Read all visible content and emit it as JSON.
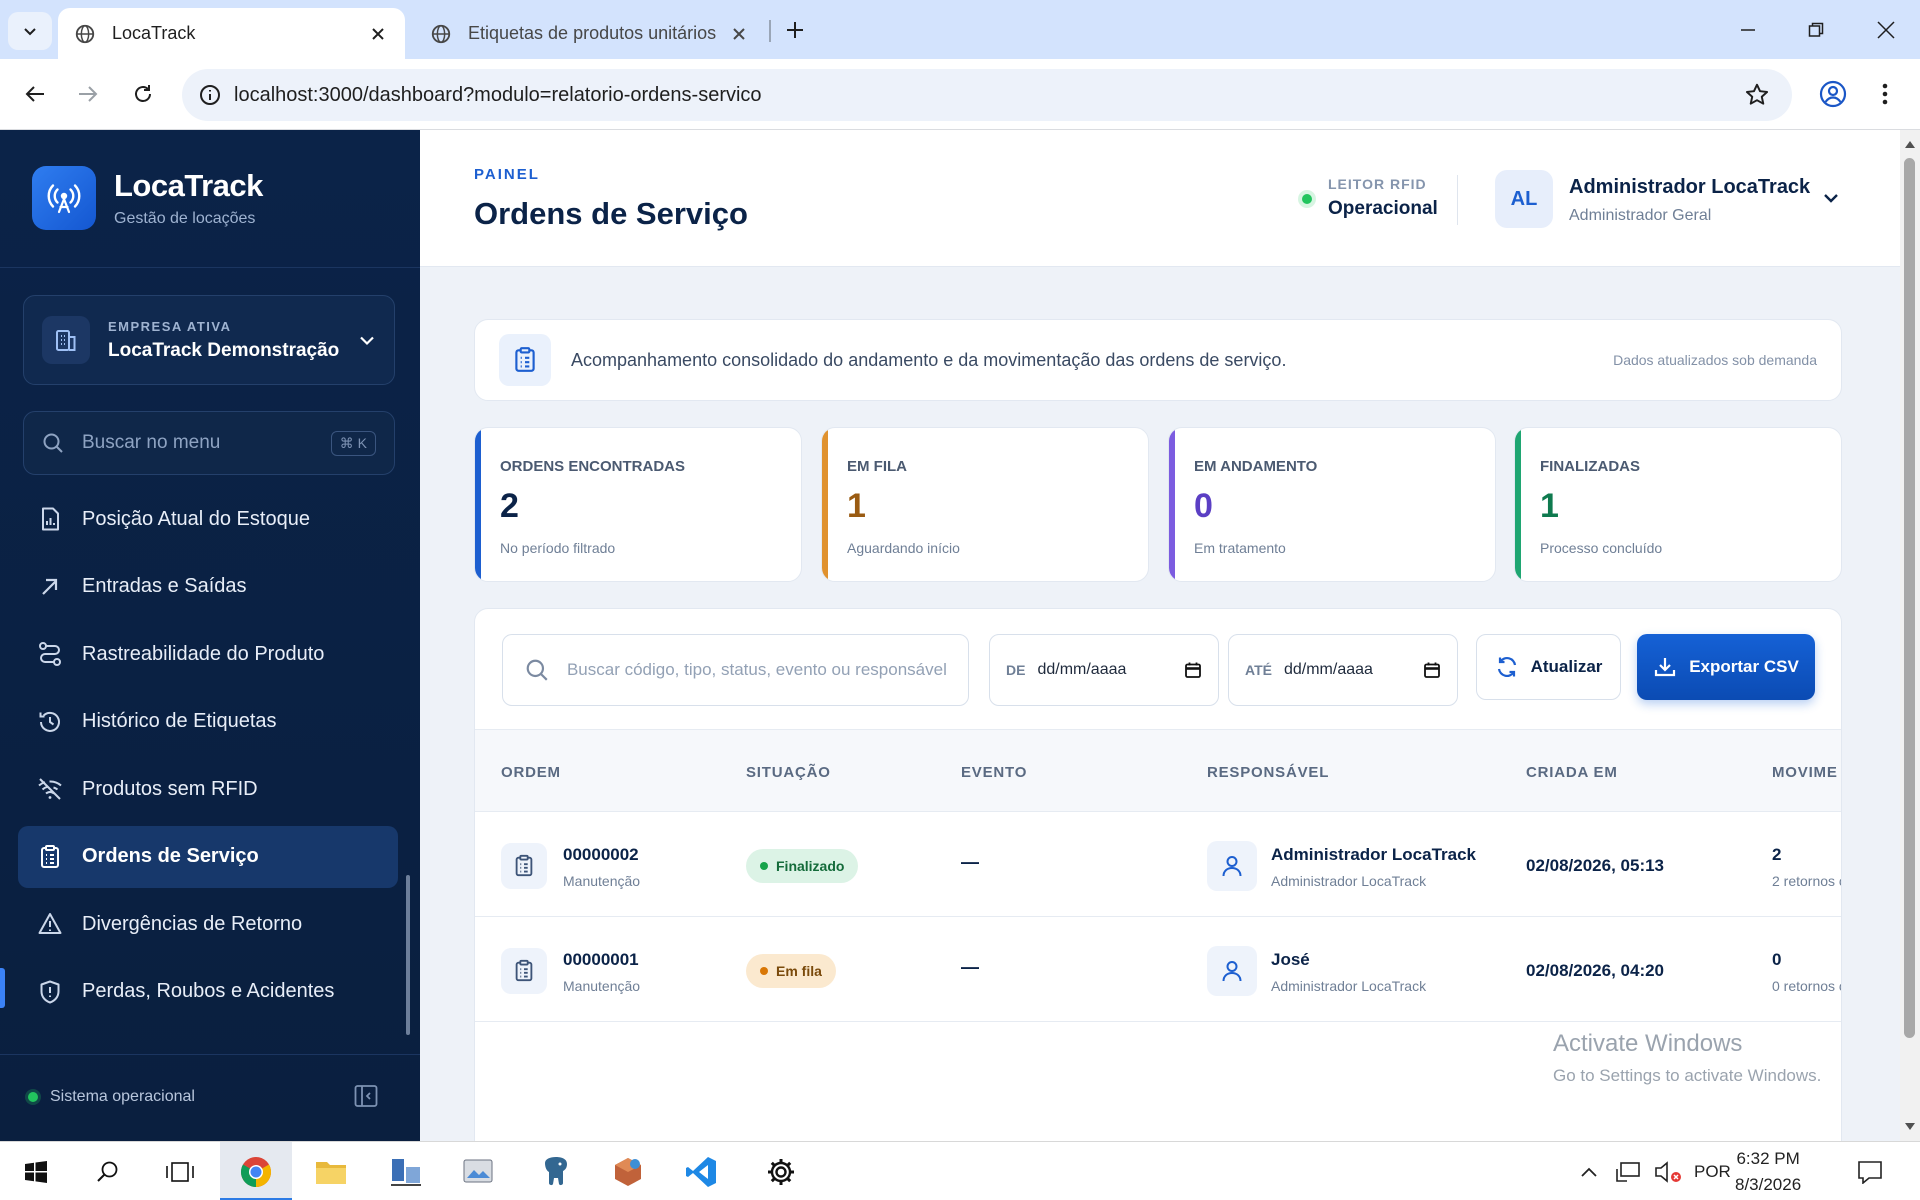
{
  "browser": {
    "tabs": [
      {
        "title": "LocaTrack",
        "active": true
      },
      {
        "title": "Etiquetas de produtos unitários",
        "active": false
      }
    ],
    "url": "localhost:3000/dashboard?modulo=relatorio-ordens-servico"
  },
  "sidebar": {
    "brand_name": "LocaTrack",
    "brand_sub": "Gestão de locações",
    "company_label": "EMPRESA ATIVA",
    "company_name": "LocaTrack Demonstração",
    "search_placeholder": "Buscar no menu",
    "search_shortcut": "⌘ K",
    "items": [
      {
        "label": "Posição Atual do Estoque",
        "icon": "inventory-report-icon"
      },
      {
        "label": "Entradas e Saídas",
        "icon": "arrow-up-right-icon"
      },
      {
        "label": "Rastreabilidade do Produto",
        "icon": "route-icon"
      },
      {
        "label": "Histórico de Etiquetas",
        "icon": "history-icon"
      },
      {
        "label": "Produtos sem RFID",
        "icon": "wifi-off-icon"
      },
      {
        "label": "Ordens de Serviço",
        "icon": "clipboard-icon",
        "active": true
      },
      {
        "label": "Divergências de Retorno",
        "icon": "warning-icon"
      },
      {
        "label": "Perdas, Roubos e Acidentes",
        "icon": "shield-alert-icon"
      }
    ],
    "status": "Sistema operacional"
  },
  "header": {
    "eyebrow": "PAINEL",
    "title": "Ordens de Serviço",
    "rfid_label": "LEITOR RFID",
    "rfid_status": "Operacional",
    "user_initials": "AL",
    "user_name": "Administrador LocaTrack",
    "user_role": "Administrador Geral"
  },
  "info": {
    "text": "Acompanhamento consolidado do andamento e da movimentação das ordens de serviço.",
    "note": "Dados atualizados sob demanda"
  },
  "stats": [
    {
      "label": "ORDENS ENCONTRADAS",
      "value": "2",
      "sub": "No período filtrado",
      "color": "#1d5fd0",
      "value_color": "#0b2348"
    },
    {
      "label": "EM FILA",
      "value": "1",
      "sub": "Aguardando início",
      "color": "#e0922f",
      "value_color": "#9a5b12"
    },
    {
      "label": "EM ANDAMENTO",
      "value": "0",
      "sub": "Em tratamento",
      "color": "#7c5ce0",
      "value_color": "#5b3fc4"
    },
    {
      "label": "FINALIZADAS",
      "value": "1",
      "sub": "Processo concluído",
      "color": "#1fa672",
      "value_color": "#0f7a4f"
    }
  ],
  "filters": {
    "search_placeholder": "Buscar código, tipo, status, evento ou responsável",
    "from_label": "DE",
    "from_value": "dd/mm/aaaa",
    "to_label": "ATÉ",
    "to_value": "dd/mm/aaaa",
    "refresh_label": "Atualizar",
    "export_label": "Exportar CSV"
  },
  "table": {
    "columns": [
      "ORDEM",
      "SITUAÇÃO",
      "EVENTO",
      "RESPONSÁVEL",
      "CRIADA EM",
      "MOVIME"
    ],
    "rows": [
      {
        "code": "00000002",
        "type": "Manutenção",
        "status": "Finalizado",
        "status_kind": "done",
        "event": "—",
        "resp_name": "Administrador LocaTrack",
        "resp_sub": "Administrador LocaTrack",
        "created": "02/08/2026, 05:13",
        "mov": "2",
        "mov_sub": "2 retornos c"
      },
      {
        "code": "00000001",
        "type": "Manutenção",
        "status": "Em fila",
        "status_kind": "queue",
        "event": "—",
        "resp_name": "José",
        "resp_sub": "Administrador LocaTrack",
        "created": "02/08/2026, 04:20",
        "mov": "0",
        "mov_sub": "0 retornos c"
      }
    ]
  },
  "watermark": {
    "line1": "Activate Windows",
    "line2": "Go to Settings to activate Windows."
  },
  "taskbar": {
    "lang": "POR",
    "time": "6:32 PM",
    "date": "8/3/2026"
  }
}
